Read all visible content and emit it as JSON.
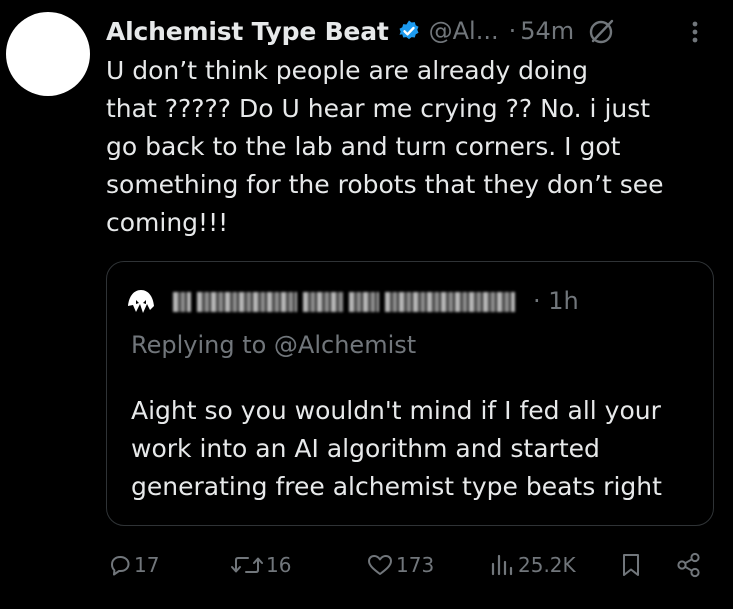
{
  "tweet": {
    "display_name": "Alchemist Type Beat",
    "handle": "@Al...",
    "separator": "·",
    "time": "54m",
    "text": "U don’t think people are already doing\nthat ?????   Do U hear me crying ?? No.  i just\ngo back to the lab and turn corners.  I got\nsomething for the robots that they don’t see\ncoming!!!"
  },
  "quote": {
    "separator": "·",
    "time": "1h",
    "replying_to": "Replying to @Alchemist",
    "text": "Aight so you wouldn't mind if I fed all your\nwork into an AI algorithm and started\ngenerating free alchemist type beats right"
  },
  "actions": {
    "replies": "17",
    "retweets": "16",
    "likes": "173",
    "views": "25.2K"
  },
  "icons": {
    "verified": "verified-badge-icon",
    "edit": "edit-history-icon",
    "more": "more-icon",
    "reply": "reply-icon",
    "retweet": "retweet-icon",
    "like": "like-icon",
    "views": "views-icon",
    "bookmark": "bookmark-icon",
    "share": "share-icon"
  },
  "colors": {
    "background": "#000000",
    "text": "#e7e9ea",
    "secondary": "#71767b",
    "verified": "#1d9bf0",
    "border": "#2f3336"
  }
}
